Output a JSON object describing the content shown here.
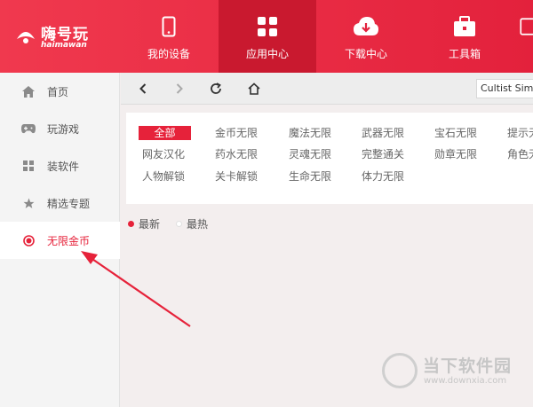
{
  "app": {
    "logo_text": "嗨号玩",
    "logo_subtext": "haimawan"
  },
  "nav": {
    "tabs": [
      {
        "label": "我的设备",
        "icon": "phone-icon"
      },
      {
        "label": "应用中心",
        "icon": "grid-icon",
        "active": true
      },
      {
        "label": "下载中心",
        "icon": "cloud-download-icon"
      },
      {
        "label": "工具箱",
        "icon": "toolbox-icon"
      }
    ]
  },
  "sidebar": {
    "items": [
      {
        "label": "首页",
        "icon": "home-icon"
      },
      {
        "label": "玩游戏",
        "icon": "gamepad-icon"
      },
      {
        "label": "装软件",
        "icon": "apps-grid-icon"
      },
      {
        "label": "精选专题",
        "icon": "star-icon"
      },
      {
        "label": "无限金币",
        "icon": "target-icon",
        "active": true
      }
    ]
  },
  "toolbar": {
    "search_value": "Cultist Simu"
  },
  "categories": {
    "rows": [
      [
        "全部",
        "金币无限",
        "魔法无限",
        "武器无限",
        "宝石无限",
        "提示无限"
      ],
      [
        "网友汉化",
        "药水无限",
        "灵魂无限",
        "完整通关",
        "勋章无限",
        "角色无限"
      ],
      [
        "人物解锁",
        "关卡解锁",
        "生命无限",
        "体力无限"
      ]
    ],
    "active": "全部"
  },
  "sort": {
    "options": [
      "最新",
      "最热"
    ],
    "selected": "最新"
  },
  "watermark": {
    "text": "当下软件园",
    "url": "www.downxia.com"
  },
  "colors": {
    "brand": "#e6223a",
    "nav_active": "#c9192f"
  }
}
